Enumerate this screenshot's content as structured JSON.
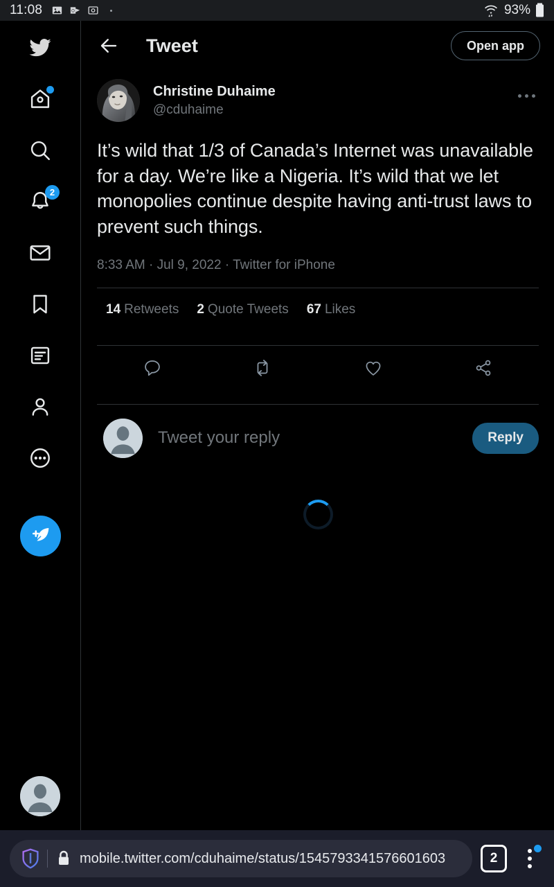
{
  "status_bar": {
    "clock": "11:08",
    "icons": [
      "photo-icon",
      "outlook-icon",
      "app-icon"
    ],
    "wifi": "wifi-icon",
    "battery_text": "93%",
    "battery_icon": "battery-icon"
  },
  "sidebar": {
    "logo": "twitter-bird-logo",
    "items": [
      {
        "name": "home",
        "icon": "home-icon",
        "badge": "",
        "badge_type": "dot"
      },
      {
        "name": "search",
        "icon": "search-icon",
        "badge": "",
        "badge_type": "none"
      },
      {
        "name": "notifications",
        "icon": "bell-icon",
        "badge": "2",
        "badge_type": "number"
      },
      {
        "name": "messages",
        "icon": "mail-icon",
        "badge": "",
        "badge_type": "none"
      },
      {
        "name": "bookmarks",
        "icon": "bookmark-icon",
        "badge": "",
        "badge_type": "none"
      },
      {
        "name": "lists",
        "icon": "lists-icon",
        "badge": "",
        "badge_type": "none"
      },
      {
        "name": "profile",
        "icon": "person-icon",
        "badge": "",
        "badge_type": "none"
      },
      {
        "name": "more",
        "icon": "more-circle-icon",
        "badge": "",
        "badge_type": "none"
      }
    ],
    "compose": "compose-feather-icon",
    "account_avatar": "default-avatar-icon"
  },
  "topbar": {
    "back": "back-arrow-icon",
    "title": "Tweet",
    "open_app_label": "Open app"
  },
  "tweet": {
    "author_name": "Christine Duhaime",
    "author_handle": "@cduhaime",
    "avatar": "christine-duhaime-avatar",
    "more_icon": "more-horizontal-icon",
    "text": "It’s wild that 1/3 of Canada’s Internet was unavailable for a day. We’re like a Nigeria. It’s wild that we let monopolies continue despite having anti-trust laws to prevent such things.",
    "timestamp": "8:33 AM · Jul 9, 2022 · Twitter for iPhone",
    "stats": [
      {
        "count": "14",
        "label": "Retweets"
      },
      {
        "count": "2",
        "label": "Quote Tweets"
      },
      {
        "count": "67",
        "label": "Likes"
      }
    ],
    "actions": [
      {
        "name": "reply",
        "icon": "comment-icon"
      },
      {
        "name": "retweet",
        "icon": "retweet-icon"
      },
      {
        "name": "like",
        "icon": "heart-icon"
      },
      {
        "name": "share",
        "icon": "share-icon"
      }
    ]
  },
  "reply_composer": {
    "avatar": "default-avatar-icon",
    "placeholder": "Tweet your reply",
    "button_label": "Reply"
  },
  "loading": {
    "spinner": "loading-spinner"
  },
  "browser_bar": {
    "shield_icon": "brave-shield-icon",
    "lock_icon": "lock-icon",
    "url": "mobile.twitter.com/cduhaime/status/1545793341576601603",
    "tab_count": "2",
    "menu_icon": "overflow-menu-icon"
  },
  "colors": {
    "accent": "#1d9bf0",
    "background": "#000000",
    "text_primary": "#e7e9ea",
    "text_secondary": "#71767b",
    "border": "#2f3336",
    "browser_bar": "#1b1d2a",
    "reply_button": "#1a5b80"
  }
}
